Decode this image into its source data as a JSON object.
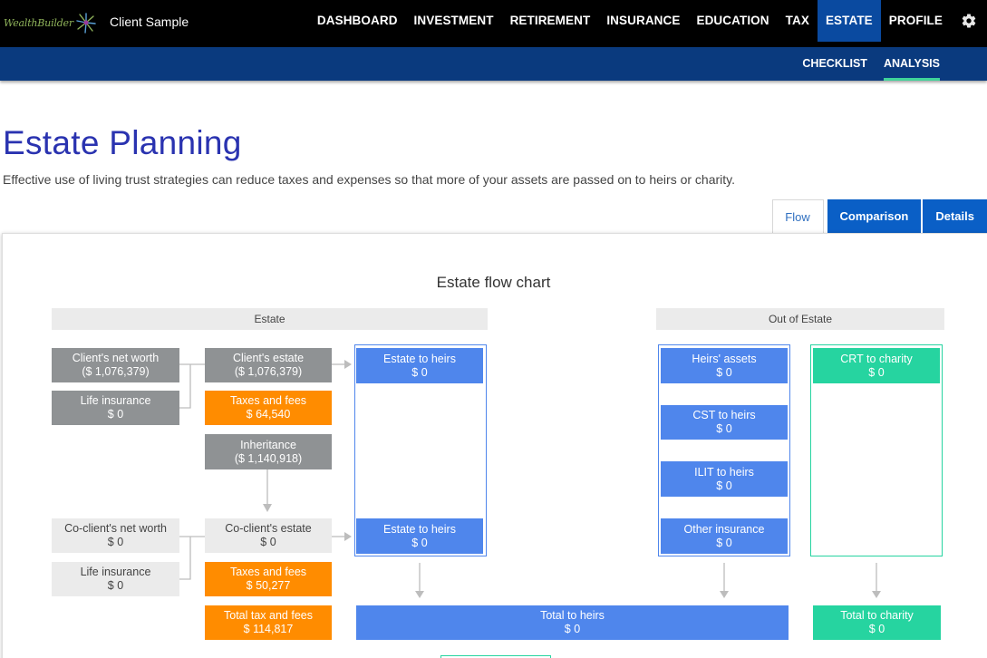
{
  "app": {
    "logo_text": "WealthBuilder",
    "client_name": "Client Sample"
  },
  "nav": {
    "items": [
      {
        "label": "DASHBOARD",
        "active": false
      },
      {
        "label": "INVESTMENT",
        "active": false
      },
      {
        "label": "RETIREMENT",
        "active": false
      },
      {
        "label": "INSURANCE",
        "active": false
      },
      {
        "label": "EDUCATION",
        "active": false
      },
      {
        "label": "TAX",
        "active": false
      },
      {
        "label": "ESTATE",
        "active": true
      },
      {
        "label": "PROFILE",
        "active": false
      }
    ],
    "settings_icon": "gear-icon"
  },
  "subnav": {
    "items": [
      {
        "label": "CHECKLIST",
        "active": false
      },
      {
        "label": "ANALYSIS",
        "active": true
      }
    ]
  },
  "page": {
    "title": "Estate Planning",
    "description": "Effective use of living trust strategies can reduce taxes and expenses so that more of your assets are passed on to heirs or charity."
  },
  "tabs": {
    "flow": "Flow",
    "comparison": "Comparison",
    "details": "Details",
    "active": "Flow"
  },
  "flow_chart": {
    "title": "Estate flow chart",
    "estate_header": "Estate",
    "out_of_estate_header": "Out of Estate",
    "client_net_worth": {
      "label": "Client's net worth",
      "value": "($ 1,076,379)"
    },
    "client_life_insurance": {
      "label": "Life insurance",
      "value": "$ 0"
    },
    "client_estate": {
      "label": "Client's estate",
      "value": "($ 1,076,379)"
    },
    "client_taxes_fees": {
      "label": "Taxes and fees",
      "value": "$ 64,540"
    },
    "inheritance": {
      "label": "Inheritance",
      "value": "($ 1,140,918)"
    },
    "coclient_net_worth": {
      "label": "Co-client's net worth",
      "value": "$ 0"
    },
    "coclient_life_insurance": {
      "label": "Life insurance",
      "value": "$ 0"
    },
    "coclient_estate": {
      "label": "Co-client's estate",
      "value": "$ 0"
    },
    "coclient_taxes_fees": {
      "label": "Taxes and fees",
      "value": "$ 50,277"
    },
    "total_tax_fees": {
      "label": "Total tax and fees",
      "value": "$ 114,817"
    },
    "estate_to_heirs_1": {
      "label": "Estate to heirs",
      "value": "$ 0"
    },
    "estate_to_heirs_2": {
      "label": "Estate to heirs",
      "value": "$ 0"
    },
    "heirs_assets": {
      "label": "Heirs' assets",
      "value": "$ 0"
    },
    "cst_to_heirs": {
      "label": "CST to heirs",
      "value": "$ 0"
    },
    "ilit_to_heirs": {
      "label": "ILIT to heirs",
      "value": "$ 0"
    },
    "other_insurance": {
      "label": "Other insurance",
      "value": "$ 0"
    },
    "crt_to_charity": {
      "label": "CRT to charity",
      "value": "$ 0"
    },
    "total_to_heirs": {
      "label": "Total to heirs",
      "value": "$ 0"
    },
    "total_to_charity": {
      "label": "Total to charity",
      "value": "$ 0"
    }
  },
  "colors": {
    "nav_bg": "#000000",
    "subnav_bg": "#0a3a7e",
    "active_nav": "#0a4aa0",
    "title": "#2a33b0",
    "gray_box": "#8f9294",
    "orange_box": "#ff8c00",
    "blue_box": "#4f86ec",
    "teal_box": "#26d4a0",
    "accent_underline": "#3fd39a"
  }
}
